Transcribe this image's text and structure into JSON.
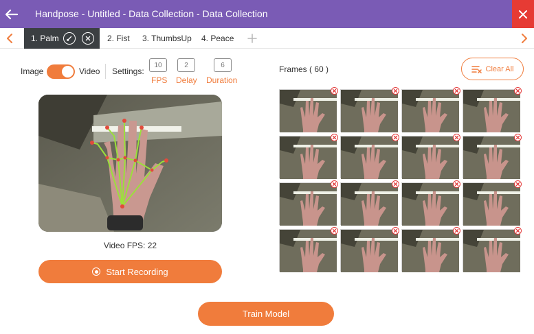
{
  "titlebar": {
    "title": "Handpose - Untitled - Data Collection - Data Collection"
  },
  "tabs": [
    {
      "label": "1. Palm"
    },
    {
      "label": "2. Fist"
    },
    {
      "label": "3. ThumbsUp"
    },
    {
      "label": "4. Peace"
    }
  ],
  "mode": {
    "left_label": "Image",
    "right_label": "Video",
    "selected": "Video"
  },
  "settings": {
    "label": "Settings:",
    "fps": {
      "value": "10",
      "label": "FPS"
    },
    "delay": {
      "value": "2",
      "label": "Delay"
    },
    "duration": {
      "value": "6",
      "label": "Duration"
    }
  },
  "video": {
    "fps_text": "Video FPS: 22"
  },
  "record": {
    "label": "Start Recording"
  },
  "frames": {
    "title": "Frames ( 60 )",
    "clear_label": "Clear All",
    "visible_count": 16
  },
  "train": {
    "label": "Train Model"
  },
  "colors": {
    "accent": "#f07c3c",
    "titlebar": "#7a5bb5",
    "close": "#e63b34",
    "tab_active": "#3b3f42",
    "delete": "#e33a3a"
  },
  "icons": {
    "back": "arrow-left-icon",
    "close": "close-icon",
    "edit": "pencil-icon",
    "tab_close": "circle-x-icon",
    "add": "plus-icon",
    "clear": "clear-list-icon",
    "record": "record-icon"
  }
}
